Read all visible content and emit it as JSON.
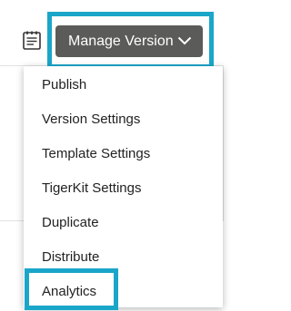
{
  "toolbar": {
    "notes_icon": "clipboard-notes-icon",
    "manage_version_label": "Manage Version",
    "chevron_icon": "chevron-down-icon",
    "button_color": "#5b5b59",
    "highlight_color": "#1aa6c9"
  },
  "menu": {
    "items": [
      {
        "label": "Publish"
      },
      {
        "label": "Version Settings"
      },
      {
        "label": "Template Settings"
      },
      {
        "label": "TigerKit Settings"
      },
      {
        "label": "Duplicate"
      },
      {
        "label": "Distribute"
      },
      {
        "label": "Analytics"
      }
    ]
  }
}
